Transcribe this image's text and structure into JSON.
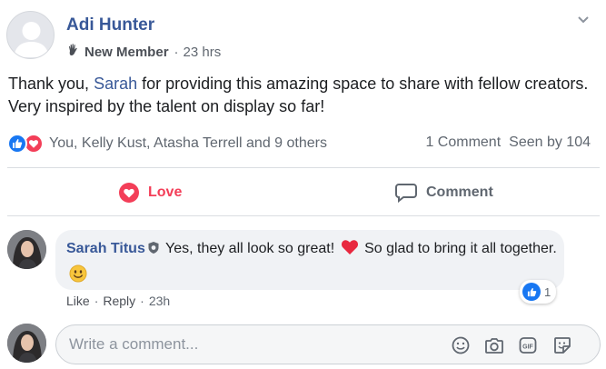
{
  "post": {
    "author": "Adi Hunter",
    "badge": "New Member",
    "time": "23 hrs",
    "text_before": "Thank you, ",
    "mention": "Sarah",
    "text_after": " for providing this amazing space to share with fellow creators. Very inspired by the talent on display so far!"
  },
  "reactions": {
    "names": "You, Kelly Kust, Atasha Terrell and 9 others",
    "comments": "1 Comment",
    "seen": "Seen by 104"
  },
  "actions": {
    "love_label": "Love",
    "comment_label": "Comment"
  },
  "comment": {
    "author": "Sarah Titus",
    "text_part1": " Yes, they all look so great! ",
    "text_part2": " So glad to bring it all together. ",
    "reaction_count": "1",
    "like_label": "Like",
    "reply_label": "Reply",
    "time": "23h"
  },
  "composer": {
    "placeholder": "Write a comment..."
  },
  "colors": {
    "link": "#385898",
    "love": "#f33e58",
    "like": "#1877f2"
  }
}
